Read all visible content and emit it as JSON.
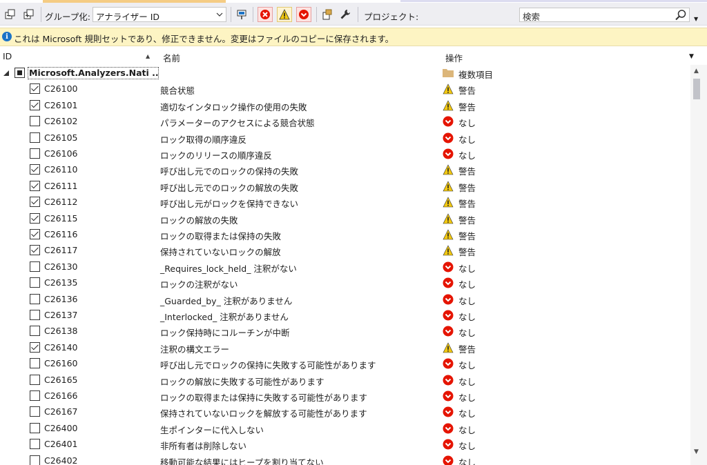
{
  "toolbar": {
    "group_label": "グループ化:",
    "group_value": "アナライザー ID",
    "project_label": "プロジェクト:",
    "search_placeholder": "検索"
  },
  "infobar": {
    "message": "これは Microsoft 規則セットであり、修正できません。変更はファイルのコピーに保存されます。"
  },
  "columns": {
    "id": "ID",
    "name": "名前",
    "action": "操作"
  },
  "group": {
    "name": "Microsoft.Analyzers.Nati ...",
    "action": "複数項目"
  },
  "rules": [
    {
      "checked": true,
      "id": "C26100",
      "name": "競合状態",
      "action": "警告",
      "icon": "warning-icon"
    },
    {
      "checked": true,
      "id": "C26101",
      "name": "適切なインタロック操作の使用の失敗",
      "action": "警告",
      "icon": "warning-icon"
    },
    {
      "checked": false,
      "id": "C26102",
      "name": "パラメーターのアクセスによる競合状態",
      "action": "なし",
      "icon": "none-icon"
    },
    {
      "checked": false,
      "id": "C26105",
      "name": "ロック取得の順序違反",
      "action": "なし",
      "icon": "none-icon"
    },
    {
      "checked": false,
      "id": "C26106",
      "name": "ロックのリリースの順序違反",
      "action": "なし",
      "icon": "none-icon"
    },
    {
      "checked": true,
      "id": "C26110",
      "name": "呼び出し元でのロックの保持の失敗",
      "action": "警告",
      "icon": "warning-icon"
    },
    {
      "checked": true,
      "id": "C26111",
      "name": "呼び出し元でのロックの解放の失敗",
      "action": "警告",
      "icon": "warning-icon"
    },
    {
      "checked": true,
      "id": "C26112",
      "name": "呼び出し元がロックを保持できない",
      "action": "警告",
      "icon": "warning-icon"
    },
    {
      "checked": true,
      "id": "C26115",
      "name": "ロックの解放の失敗",
      "action": "警告",
      "icon": "warning-icon"
    },
    {
      "checked": true,
      "id": "C26116",
      "name": "ロックの取得または保持の失敗",
      "action": "警告",
      "icon": "warning-icon"
    },
    {
      "checked": true,
      "id": "C26117",
      "name": "保持されていないロックの解放",
      "action": "警告",
      "icon": "warning-icon"
    },
    {
      "checked": false,
      "id": "C26130",
      "name": "_Requires_lock_held_ 注釈がない",
      "action": "なし",
      "icon": "none-icon"
    },
    {
      "checked": false,
      "id": "C26135",
      "name": "ロックの注釈がない",
      "action": "なし",
      "icon": "none-icon"
    },
    {
      "checked": false,
      "id": "C26136",
      "name": "_Guarded_by_ 注釈がありません",
      "action": "なし",
      "icon": "none-icon"
    },
    {
      "checked": false,
      "id": "C26137",
      "name": "_Interlocked_ 注釈がありません",
      "action": "なし",
      "icon": "none-icon"
    },
    {
      "checked": false,
      "id": "C26138",
      "name": "ロック保持時にコルーチンが中断",
      "action": "なし",
      "icon": "none-icon"
    },
    {
      "checked": true,
      "id": "C26140",
      "name": "注釈の構文エラー",
      "action": "警告",
      "icon": "warning-icon"
    },
    {
      "checked": false,
      "id": "C26160",
      "name": "呼び出し元でロックの保持に失敗する可能性があります",
      "action": "なし",
      "icon": "none-icon"
    },
    {
      "checked": false,
      "id": "C26165",
      "name": "ロックの解放に失敗する可能性があります",
      "action": "なし",
      "icon": "none-icon"
    },
    {
      "checked": false,
      "id": "C26166",
      "name": "ロックの取得または保持に失敗する可能性があります",
      "action": "なし",
      "icon": "none-icon"
    },
    {
      "checked": false,
      "id": "C26167",
      "name": "保持されていないロックを解放する可能性があります",
      "action": "なし",
      "icon": "none-icon"
    },
    {
      "checked": false,
      "id": "C26400",
      "name": "生ポインターに代入しない",
      "action": "なし",
      "icon": "none-icon"
    },
    {
      "checked": false,
      "id": "C26401",
      "name": "非所有者は削除しない",
      "action": "なし",
      "icon": "none-icon"
    },
    {
      "checked": false,
      "id": "C26402",
      "name": "移動可能な結果にはヒープを割り当てない",
      "action": "なし",
      "icon": "none-icon"
    }
  ],
  "colors": {
    "warning": "#f2c811",
    "none": "#e51400",
    "info": "#1c73c7",
    "infobar_bg": "#fdf4c3"
  }
}
